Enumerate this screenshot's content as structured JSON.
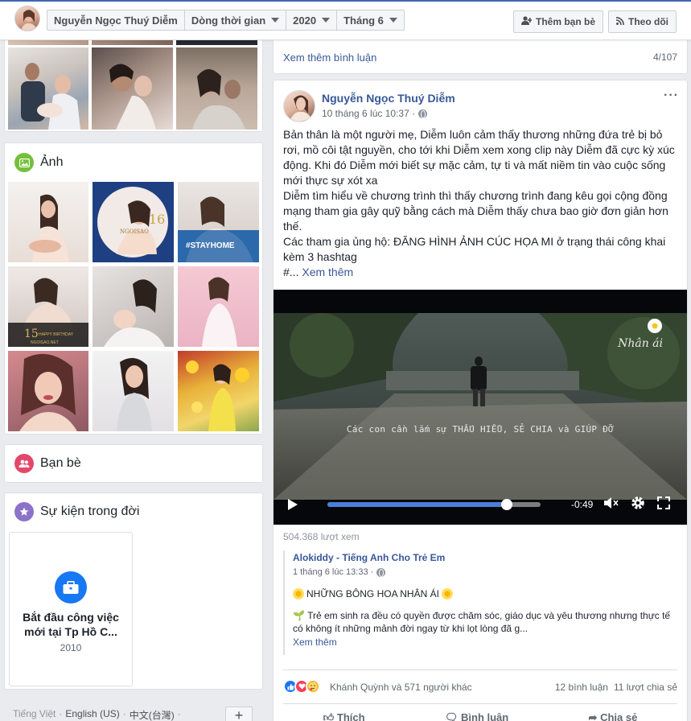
{
  "header": {
    "profile_name": "Nguyễn Ngọc Thuý Diễm",
    "timeline_label": "Dòng thời gian",
    "year_label": "2020",
    "month_label": "Tháng 6",
    "add_friend_label": "Thêm bạn bè",
    "follow_label": "Theo dõi"
  },
  "left": {
    "photos_title": "Ảnh",
    "friends_title": "Bạn bè",
    "life_events_title": "Sự kiện trong đời",
    "life_event": {
      "title": "Bắt đầu công việc mới tại Tp Hồ C...",
      "year": "2010"
    },
    "footer_links": [
      "Tiếng Việt",
      "English (US)",
      "中文(台灣)"
    ],
    "footer_sep": "·",
    "footer_plus": "+"
  },
  "previous_post": {
    "more_comments_label": "Xem thêm bình luận",
    "comment_count": "4/107"
  },
  "post": {
    "author": "Nguyễn Ngọc Thuý Diễm",
    "time": "10 tháng 6 lúc 10:37 ·",
    "more_icon": "···",
    "paragraph1": "Bản thân là một người mẹ, Diễm luôn cảm thấy thương những đứa trẻ bị bỏ rơi, mồ côi tật nguyền, cho tới khi Diễm xem xong clip này Diễm đã cực kỳ xúc động. Khi đó Diễm mới biết sự mặc cảm, tự ti và mất niềm tin vào cuộc sống mới thực sự xót xa",
    "paragraph2": "Diễm tìm hiểu về chương trình thì thấy chương trình đang kêu gọi cộng đồng mạng tham gia gây quỹ bằng cách mà Diễm thấy chưa bao giờ đơn giản hơn thế.",
    "paragraph3": "Các tham gia ủng hộ: ĐĂNG HÌNH ẢNH CÚC HỌA MI ở trạng thái công khai kèm 3 hashtag",
    "see_more_prefix": "#...",
    "see_more_label": "Xem thêm",
    "video": {
      "caption": "Các con cần lắm sự THẤU HIỂU, SẺ CHIA và GIÚP ĐỠ",
      "logo_text": "Nhân ái",
      "time_remaining": "-0:49",
      "progress_fraction": 0.84
    },
    "views": "504.368 lượt xem",
    "shared": {
      "author": "Alokiddy - Tiếng Anh Cho Trẻ Em",
      "time": "1 tháng 6 lúc 13:33 ·",
      "title": "NHỮNG BÔNG HOA NHÂN ÁI",
      "body": "Trẻ em sinh ra đều có quyền được chăm sóc, giáo dục và yêu thương nhưng thực tế có không ít những mảnh đời ngay từ khi lọt lòng đã g...",
      "see_more": "Xem thêm"
    },
    "reactions_text": "Khánh Quỳnh và 571 người khác",
    "comments_count": "12 bình luận",
    "shares_count": "11 lượt chia sẻ",
    "actions": [
      "Thích",
      "Bình luận",
      "Chia sẻ"
    ]
  },
  "colors": {
    "facebook_blue": "#4267b2",
    "link_blue": "#385898",
    "photos_icon_bg": "#74c03a",
    "friends_icon_bg": "#e2486c",
    "events_icon_bg": "#8c72cb",
    "video_progress": "#4a7fd9"
  }
}
